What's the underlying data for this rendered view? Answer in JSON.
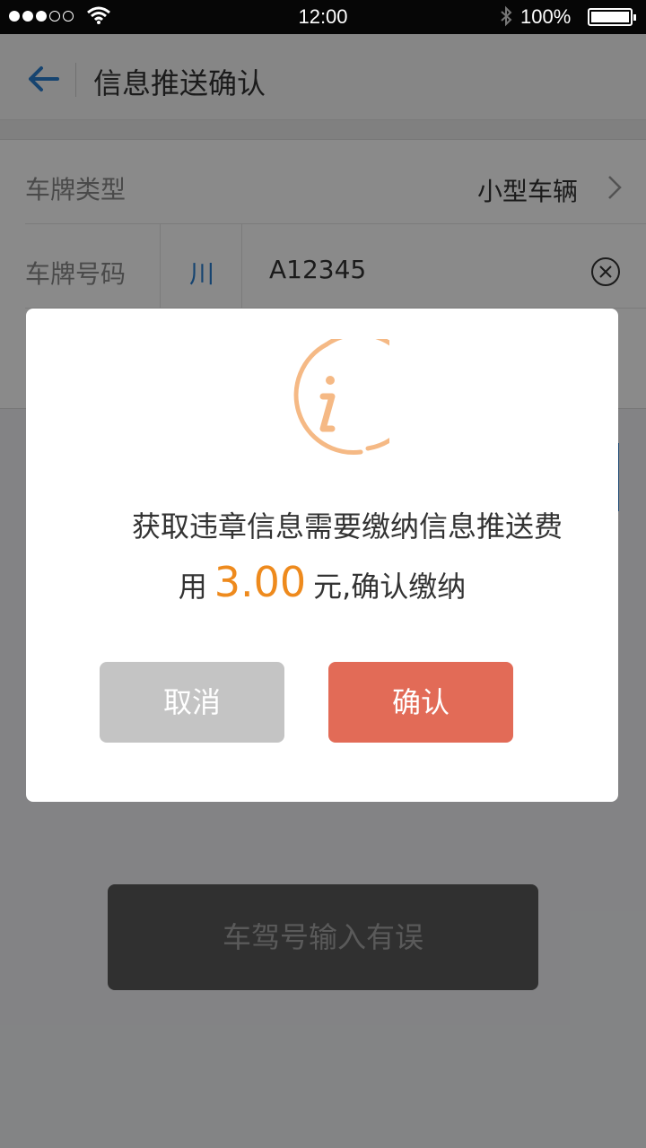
{
  "status_bar": {
    "time": "12:00",
    "battery": "100%",
    "signal_bars_filled": 3,
    "signal_bars_total": 5
  },
  "header": {
    "title": "信息推送确认",
    "back_icon": "arrow-left-icon"
  },
  "form": {
    "plate_type_label": "车牌类型",
    "plate_type_value": "小型车辆",
    "plate_number_label": "车牌号码",
    "province": "川",
    "plate_number": "A12345"
  },
  "background_toast": "车驾号输入有误",
  "dialog": {
    "icon": "info-icon",
    "message_line1": "获取违章信息需要缴纳信息推送费",
    "message_prefix": "用",
    "amount": "3.00",
    "message_suffix": "元,确认缴纳",
    "cancel_label": "取消",
    "confirm_label": "确认"
  },
  "colors": {
    "accent_blue": "#2a7fd0",
    "amount_orange": "#ee8a1d",
    "icon_orange": "#f5b985",
    "confirm_red": "#e26b57",
    "cancel_gray": "#c4c4c4"
  }
}
